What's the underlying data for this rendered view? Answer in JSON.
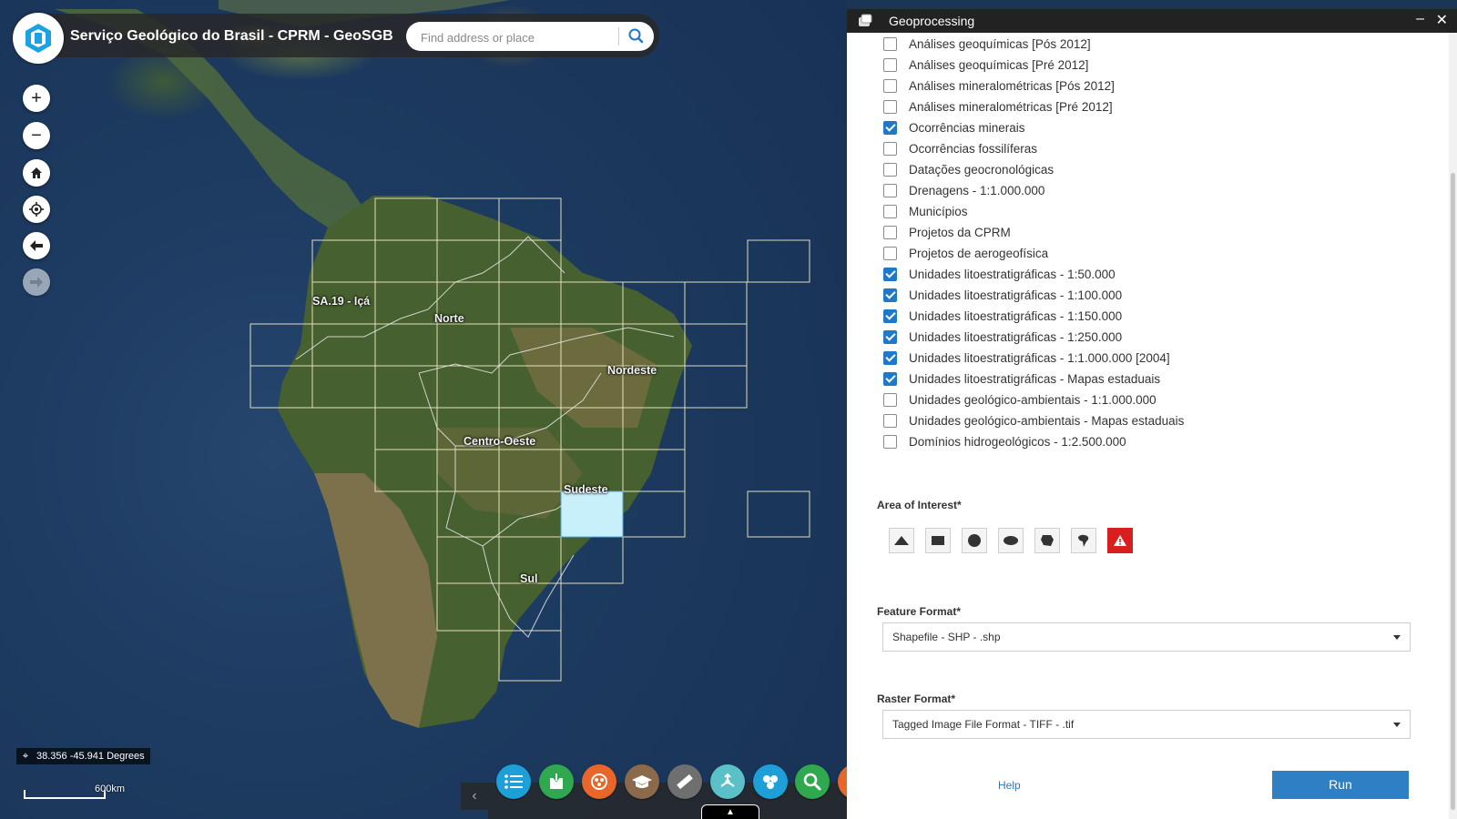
{
  "app": {
    "title": "Serviço Geológico do Brasil - CPRM - GeoSGB",
    "logo_icon": "cprm-logo-icon"
  },
  "search": {
    "placeholder": "Find address or place",
    "icon": "search-icon"
  },
  "map": {
    "labels": [
      "SA.19 - Içá",
      "Norte",
      "Nordeste",
      "Centro-Oeste",
      "Sudeste",
      "Sul"
    ],
    "nav_buttons": [
      "zoom-in",
      "zoom-out",
      "home",
      "my-location",
      "previous-extent",
      "next-extent"
    ],
    "coordinates": "38.356 -45.941 Degrees",
    "scale": "600km"
  },
  "toolbar": {
    "tools": [
      {
        "name": "layer-list-icon",
        "color": "#1f9fd8"
      },
      {
        "name": "basemap-icon",
        "color": "#2fa84f"
      },
      {
        "name": "bio-icon",
        "color": "#e8662a"
      },
      {
        "name": "education-icon",
        "color": "#8a6a4a"
      },
      {
        "name": "measure-icon",
        "color": "#6f6f6f"
      },
      {
        "name": "share-icon",
        "color": "#5cc0c8"
      },
      {
        "name": "cluster-icon",
        "color": "#1f9fd8"
      },
      {
        "name": "query-icon",
        "color": "#2fa84f"
      }
    ]
  },
  "panel": {
    "title": "Geoprocessing",
    "minimize_icon": "minimize-icon",
    "close_icon": "close-icon",
    "layers": [
      {
        "label": "Análises geoquímicas [Pós 2012]",
        "checked": false
      },
      {
        "label": "Análises geoquímicas [Pré 2012]",
        "checked": false
      },
      {
        "label": "Análises mineralométricas [Pós 2012]",
        "checked": false
      },
      {
        "label": "Análises mineralométricas [Pré 2012]",
        "checked": false
      },
      {
        "label": "Ocorrências minerais",
        "checked": true
      },
      {
        "label": "Ocorrências fossilíferas",
        "checked": false
      },
      {
        "label": "Datações geocronológicas",
        "checked": false
      },
      {
        "label": "Drenagens - 1:1.000.000",
        "checked": false
      },
      {
        "label": "Municípios",
        "checked": false
      },
      {
        "label": "Projetos da CPRM",
        "checked": false
      },
      {
        "label": "Projetos de aerogeofísica",
        "checked": false
      },
      {
        "label": "Unidades litoestratigráficas - 1:50.000",
        "checked": true
      },
      {
        "label": "Unidades litoestratigráficas - 1:100.000",
        "checked": true
      },
      {
        "label": "Unidades litoestratigráficas - 1:150.000",
        "checked": true
      },
      {
        "label": "Unidades litoestratigráficas - 1:250.000",
        "checked": true
      },
      {
        "label": "Unidades litoestratigráficas - 1:1.000.000 [2004]",
        "checked": true
      },
      {
        "label": "Unidades litoestratigráficas - Mapas estaduais",
        "checked": true
      },
      {
        "label": "Unidades geológico-ambientais - 1:1.000.000",
        "checked": false
      },
      {
        "label": "Unidades geológico-ambientais - Mapas estaduais",
        "checked": false
      },
      {
        "label": "Domínios hidrogeológicos - 1:2.500.000",
        "checked": false
      }
    ],
    "area_of_interest_label": "Area of Interest*",
    "shape_tools": [
      "triangle-icon",
      "rectangle-icon",
      "circle-icon",
      "ellipse-icon",
      "polygon-icon",
      "freehand-icon",
      "warning-icon"
    ],
    "feature_format_label": "Feature Format*",
    "feature_format_value": "Shapefile - SHP - .shp",
    "raster_format_label": "Raster Format*",
    "raster_format_value": "Tagged Image File Format - TIFF - .tif",
    "help_label": "Help",
    "run_label": "Run"
  }
}
